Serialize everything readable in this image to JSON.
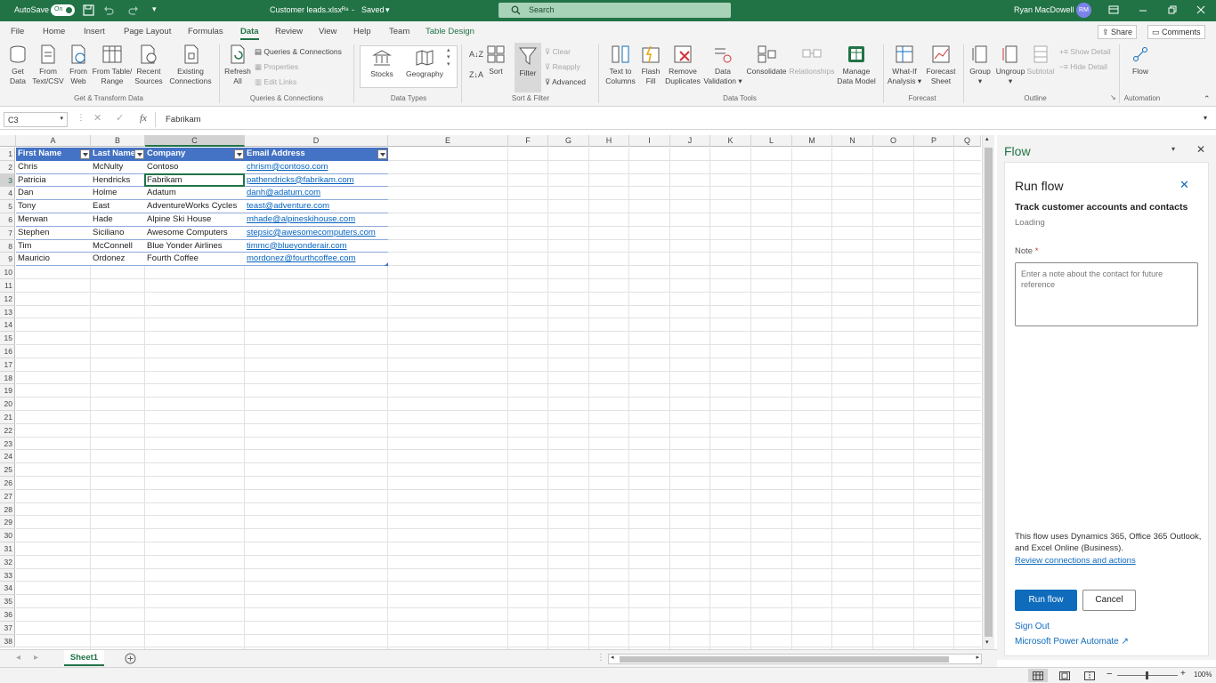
{
  "titlebar": {
    "autosave_label": "AutoSave",
    "autosave_state": "On",
    "file_name": "Customer leads.xlsx",
    "save_status": "Saved",
    "search_placeholder": "Search",
    "user_name": "Ryan MacDowell",
    "user_initials": "RM"
  },
  "tabs": [
    "File",
    "Home",
    "Insert",
    "Page Layout",
    "Formulas",
    "Data",
    "Review",
    "View",
    "Help",
    "Team",
    "Table Design"
  ],
  "active_tab": "Data",
  "share_label": "Share",
  "comments_label": "Comments",
  "ribbon": {
    "get_data": [
      "Get",
      "Data"
    ],
    "from_text": [
      "From",
      "Text/CSV"
    ],
    "from_web": [
      "From",
      "Web"
    ],
    "from_table": [
      "From Table/",
      "Range"
    ],
    "recent_sources": [
      "Recent",
      "Sources"
    ],
    "existing_connections": [
      "Existing",
      "Connections"
    ],
    "group_get_transform": "Get & Transform Data",
    "refresh_all": [
      "Refresh",
      "All"
    ],
    "queries_connections": "Queries & Connections",
    "properties": "Properties",
    "edit_links": "Edit Links",
    "group_queries": "Queries & Connections",
    "stocks": "Stocks",
    "geography": "Geography",
    "group_data_types": "Data Types",
    "sort": "Sort",
    "filter": "Filter",
    "clear": "Clear",
    "reapply": "Reapply",
    "advanced": "Advanced",
    "group_sort_filter": "Sort & Filter",
    "text_to_columns": [
      "Text to",
      "Columns"
    ],
    "flash_fill": [
      "Flash",
      "Fill"
    ],
    "remove_duplicates": [
      "Remove",
      "Duplicates"
    ],
    "data_validation": [
      "Data",
      "Validation"
    ],
    "consolidate": "Consolidate",
    "relationships": "Relationships",
    "manage_data_model": [
      "Manage",
      "Data Model"
    ],
    "group_data_tools": "Data Tools",
    "what_if": [
      "What-If",
      "Analysis"
    ],
    "forecast_sheet": [
      "Forecast",
      "Sheet"
    ],
    "group_forecast": "Forecast",
    "group_btn": "Group",
    "ungroup": "Ungroup",
    "subtotal": "Subtotal",
    "show_detail": "Show Detail",
    "hide_detail": "Hide Detail",
    "group_outline": "Outline",
    "flow": "Flow",
    "group_automation": "Automation"
  },
  "formula_bar": {
    "name_box": "C3",
    "fx": "fx",
    "value": "Fabrikam"
  },
  "sheet": {
    "columns": [
      "A",
      "B",
      "C",
      "D",
      "E",
      "F",
      "G",
      "H",
      "I",
      "J",
      "K",
      "L",
      "M",
      "N",
      "O",
      "P",
      "Q"
    ],
    "row_numbers": [
      "1",
      "2",
      "3",
      "4",
      "5",
      "6",
      "7",
      "8",
      "9",
      "10",
      "11",
      "12",
      "13",
      "14",
      "15",
      "16",
      "17",
      "18",
      "19",
      "20",
      "21",
      "22",
      "23",
      "24",
      "25",
      "26",
      "27",
      "28",
      "29",
      "30",
      "31",
      "32",
      "33",
      "34",
      "35",
      "36",
      "37",
      "38"
    ],
    "headers": [
      "First Name",
      "Last Name",
      "Company",
      "Email Address"
    ],
    "rows": [
      [
        "Chris",
        "McNulty",
        "Contoso",
        "chrism@contoso.com"
      ],
      [
        "Patricia",
        "Hendricks",
        "Fabrikam",
        "pathendricks@fabrikam.com"
      ],
      [
        "Dan",
        "Holme",
        "Adatum",
        "danh@adatum.com"
      ],
      [
        "Tony",
        "East",
        "AdventureWorks Cycles",
        "teast@adventure.com"
      ],
      [
        "Merwan",
        "Hade",
        "Alpine Ski House",
        "mhade@alpineskihouse.com"
      ],
      [
        "Stephen",
        "Siciliano",
        "Awesome Computers",
        "stepsic@awesomecomputers.com"
      ],
      [
        "Tim",
        "McConnell",
        "Blue Yonder Airlines",
        "timmc@blueyonderair.com"
      ],
      [
        "Mauricio",
        "Ordonez",
        "Fourth Coffee",
        "mordonez@fourthcoffee.com"
      ]
    ],
    "selected_cell": "C3",
    "sheet_tab": "Sheet1"
  },
  "flow_pane": {
    "title": "Flow",
    "card_title": "Run flow",
    "flow_name": "Track customer accounts and contacts",
    "status": "Loading",
    "note_label": "Note",
    "note_required": "*",
    "note_placeholder": "Enter a note about the contact for future reference",
    "disclaimer": "This flow uses Dynamics 365, Office 365 Outlook, and Excel Online (Business).",
    "review_link": "Review connections and actions",
    "run_button": "Run flow",
    "cancel_button": "Cancel",
    "sign_out": "Sign Out",
    "power_automate_link": "Microsoft Power Automate"
  },
  "status_bar": {
    "zoom": "100%"
  },
  "colors": {
    "excel_green": "#217346",
    "table_header": "#4472c4",
    "link": "#0563c1",
    "primary_button": "#0f6cbd"
  }
}
